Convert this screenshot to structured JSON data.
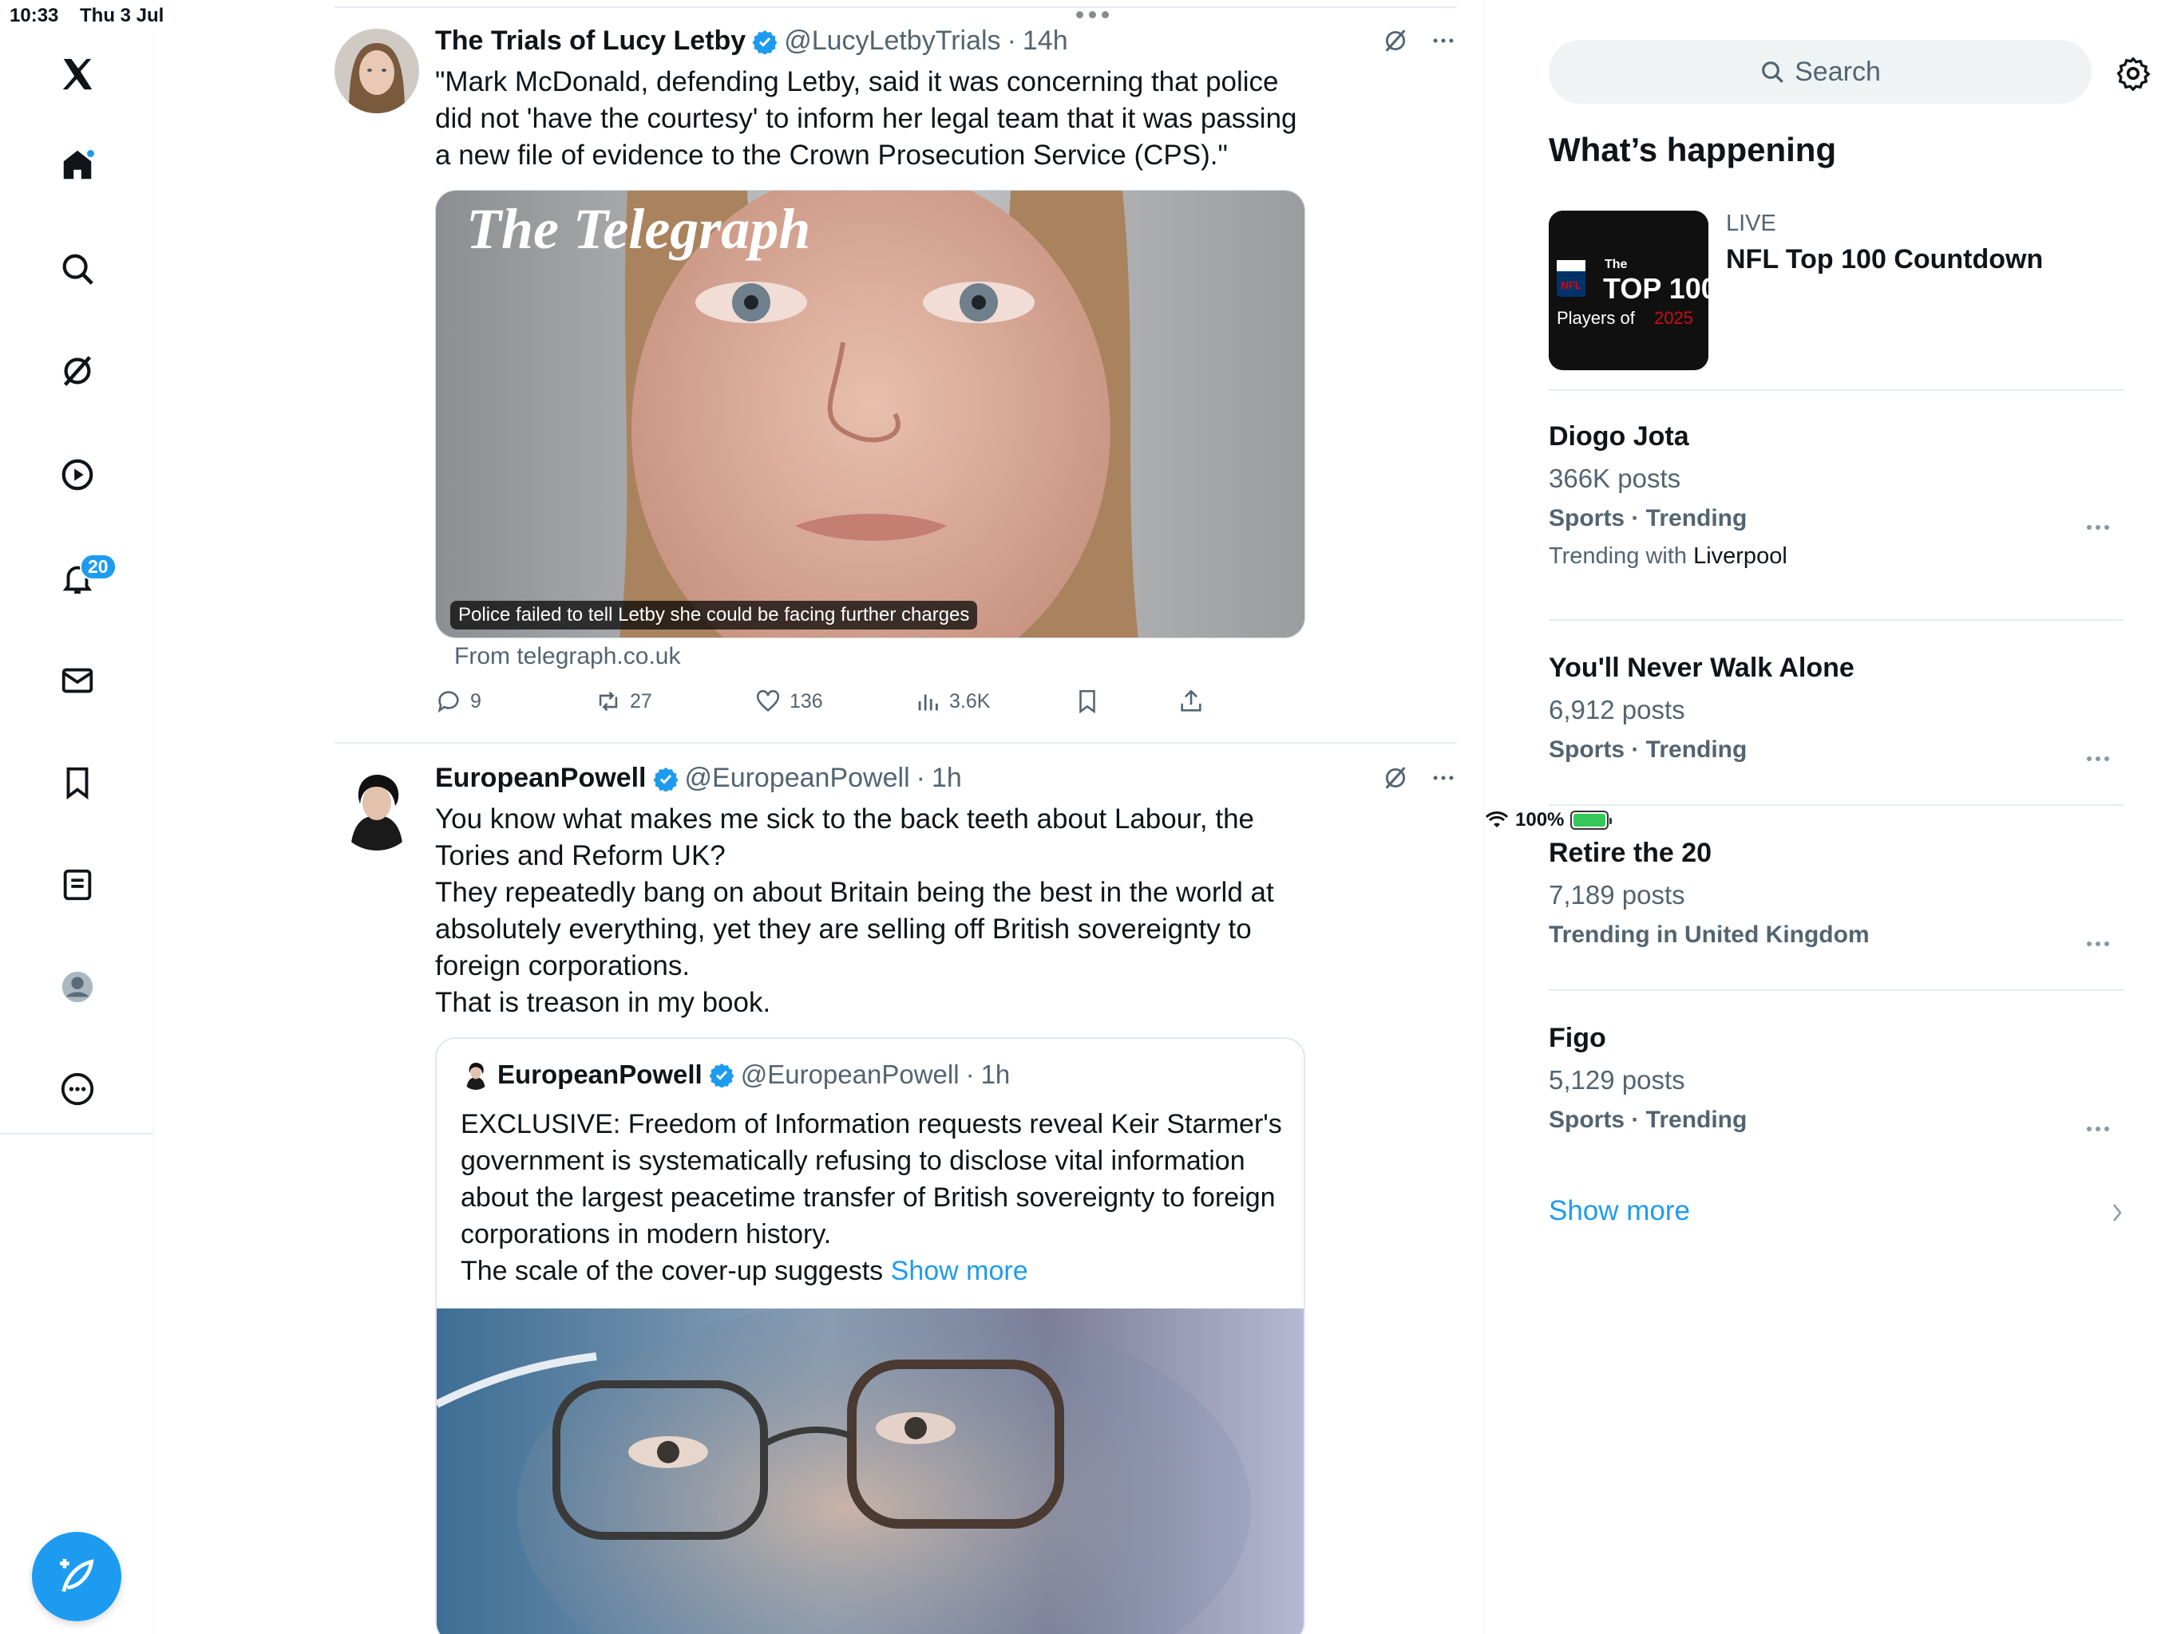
{
  "status": {
    "time": "10:33",
    "date": "Thu 3 Jul",
    "battery": "100%",
    "battery_level": 1.0
  },
  "nav": {
    "notifications_count": "20",
    "colors": {
      "accent": "#1d9bf0",
      "text": "#0f1419",
      "muted": "#536471"
    },
    "icons": [
      "x-logo-icon",
      "home-icon",
      "search-icon",
      "grok-icon",
      "video-icon",
      "bell-icon",
      "mail-icon",
      "bookmark-icon",
      "list-icon",
      "profile-icon",
      "more-icon",
      "compose-icon"
    ]
  },
  "posts": [
    {
      "name": "The Trials of Lucy Letby",
      "handle": "@LucyLetbyTrials",
      "time": "14h",
      "text": "\"Mark McDonald, defending Letby, said it was concerning that police did not 'have the courtesy' to inform her legal team that it was passing a new file of evidence to the Crown Prosecution Service (CPS).\"",
      "card_brand": "The Telegraph",
      "card_caption": "Police failed to tell Letby she could be facing further charges",
      "card_source": "From telegraph.co.uk",
      "replies": "9",
      "reposts": "27",
      "likes": "136",
      "views": "3.6K"
    },
    {
      "name": "EuropeanPowell",
      "handle": "@EuropeanPowell",
      "time": "1h",
      "text_lines": [
        "You know what makes me sick to the back teeth about Labour, the Tories and Reform UK?",
        "They repeatedly bang on about Britain being the best in the world at absolutely everything, yet they are selling off British sovereignty to foreign corporations.",
        "That is treason in my book."
      ],
      "quote": {
        "name": "EuropeanPowell",
        "handle": "@EuropeanPowell",
        "time": "1h",
        "text_main": "EXCLUSIVE: Freedom of Information requests reveal Keir Starmer's government is systematically refusing to disclose vital information about the largest peacetime transfer of British sovereignty to foreign corporations in modern history.",
        "text_tail": "The scale of the cover-up suggests",
        "show_more": "Show more"
      }
    }
  ],
  "sidebar": {
    "search_placeholder": "Search",
    "title": "What’s happening",
    "live": {
      "label": "LIVE",
      "title": "NFL Top 100 Countdown",
      "thumb_line1": "The",
      "thumb_line2": "TOP 100",
      "thumb_line3": "Players of",
      "thumb_year": "2025",
      "thumb_badge": "NFL"
    },
    "trends": [
      {
        "name": "Diogo Jota",
        "count": "366K posts",
        "category": "Sports · Trending",
        "with_prefix": "Trending with",
        "with_value": "Liverpool"
      },
      {
        "name": "You'll Never Walk Alone",
        "count": "6,912 posts",
        "category": "Sports · Trending"
      },
      {
        "name": "Retire the 20",
        "count": "7,189 posts",
        "category": "Trending in United Kingdom"
      },
      {
        "name": "Figo",
        "count": "5,129 posts",
        "category": "Sports · Trending"
      }
    ],
    "show_more": "Show more"
  }
}
